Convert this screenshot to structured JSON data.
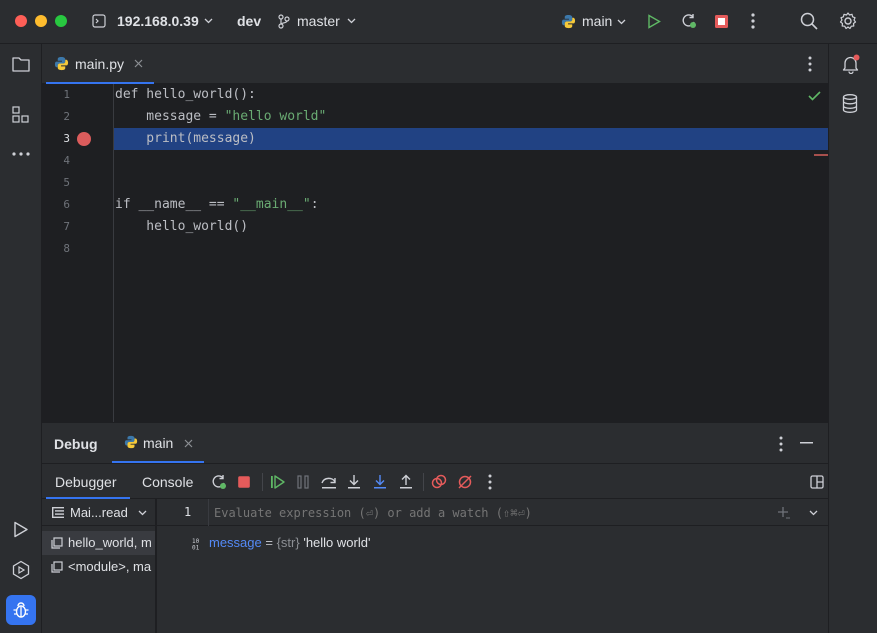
{
  "titlebar": {
    "host": "192.168.0.39",
    "project": "dev",
    "branch": "master",
    "run_config": "main"
  },
  "editor": {
    "tab": {
      "label": "main.py"
    },
    "lines": [
      {
        "num": "1",
        "code": "def hello_world():"
      },
      {
        "num": "2",
        "code": "    message = ",
        "string": "\"hello world\""
      },
      {
        "num": "3",
        "code": "    print(message)",
        "highlighted": true,
        "breakpoint": true
      },
      {
        "num": "4",
        "code": ""
      },
      {
        "num": "5",
        "code": ""
      },
      {
        "num": "6",
        "code": "if __name__ == ",
        "string": "\"__main__\"",
        "tail": ":"
      },
      {
        "num": "7",
        "code": "    hello_world()"
      },
      {
        "num": "8",
        "code": ""
      }
    ]
  },
  "debug": {
    "title": "Debug",
    "session_tab": "main",
    "tabs": [
      "Debugger",
      "Console"
    ],
    "thread_selector": "Mai...read",
    "frames": [
      "hello_world, m",
      "<module>, ma"
    ],
    "watch": {
      "line_number": "1",
      "placeholder": "Evaluate expression (⏎) or add a watch (⇧⌘⏎)"
    },
    "variables": [
      {
        "name": "message",
        "type": "{str}",
        "value": "'hello world'"
      }
    ]
  },
  "colors": {
    "accent": "#3574f0",
    "highlight_line": "#214283",
    "breakpoint": "#db5c5c",
    "run_green": "#5fb865",
    "stop_red": "#e55b5b"
  }
}
